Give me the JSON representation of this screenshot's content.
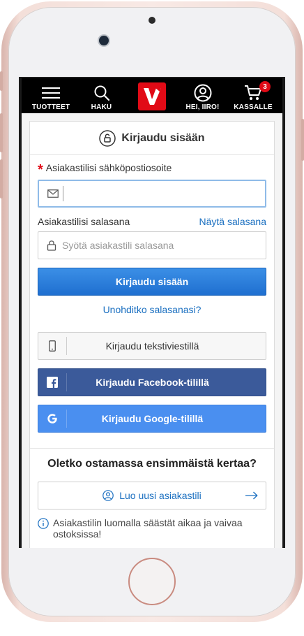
{
  "nav": {
    "menu_label": "TUOTTEET",
    "search_label": "HAKU",
    "logo_letter": "V",
    "account_label": "HEI, IIRO!",
    "cart_label": "KASSALLE",
    "cart_count": "3"
  },
  "login": {
    "title": "Kirjaudu sisään",
    "required_mark": "*",
    "email_label": "Asiakastilisi sähköpostiosoite",
    "email_value": "",
    "password_label": "Asiakastilisi salasana",
    "show_password": "Näytä salasana",
    "password_placeholder": "Syötä asiakastili salasana",
    "submit_label": "Kirjaudu sisään",
    "forgot_link": "Unohditko salasanasi?",
    "sms_label": "Kirjaudu tekstiviestillä",
    "facebook_label": "Kirjaudu Facebook-tilillä",
    "google_label": "Kirjaudu Google-tilillä"
  },
  "register": {
    "title": "Oletko ostamassa ensimmäistä kertaa?",
    "create_label": "Luo uusi asiakastili",
    "info_text": "Asiakastilin luomalla säästät aikaa ja vaivaa ostoksissa!"
  },
  "colors": {
    "brand_red": "#e10a16",
    "primary_blue": "#1f6fd0",
    "facebook_blue": "#3b5a9a",
    "google_blue": "#4a8ff0",
    "link_blue": "#1a6fc0"
  }
}
